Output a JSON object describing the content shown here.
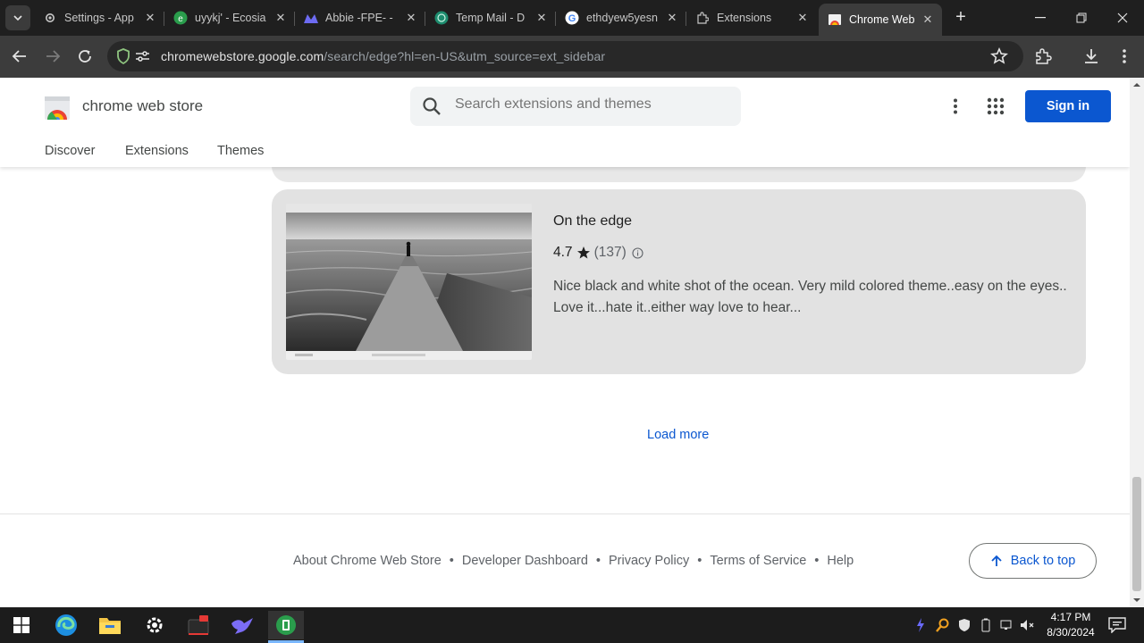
{
  "browser": {
    "tabs": [
      {
        "title": "Settings - App",
        "icon": "gear-icon"
      },
      {
        "title": "uyykj' - Ecosia",
        "icon": "ecosia-icon"
      },
      {
        "title": "Abbie -FPE- -",
        "icon": "abbie-icon"
      },
      {
        "title": "Temp Mail - D",
        "icon": "tempmail-icon"
      },
      {
        "title": "ethdyew5yesn",
        "icon": "google-icon"
      },
      {
        "title": "Extensions",
        "icon": "puzzle-icon"
      },
      {
        "title": "Chrome Web",
        "icon": "chrome-web-store-icon"
      }
    ],
    "url_main": "chromewebstore.google.com",
    "url_rest": "/search/edge?hl=en-US&utm_source=ext_sidebar"
  },
  "store": {
    "brand": "chrome web store",
    "search_placeholder": "Search extensions and themes",
    "signin": "Sign in",
    "nav": {
      "discover": "Discover",
      "extensions": "Extensions",
      "themes": "Themes"
    }
  },
  "result": {
    "title": "On the edge",
    "rating": "4.7",
    "count": "(137)",
    "description": "Nice black and white shot of the ocean. Very mild colored theme..easy on the eyes.. Love it...hate it..either way love to hear..."
  },
  "load_more": "Load more",
  "footer": {
    "links": [
      "About Chrome Web Store",
      "Developer Dashboard",
      "Privacy Policy",
      "Terms of Service",
      "Help"
    ],
    "back_to_top": "Back to top"
  },
  "taskbar": {
    "time": "4:17 PM",
    "date": "8/30/2024"
  },
  "colors": {
    "accent": "#0b57d0",
    "card": "#e2e2e2",
    "chrome_dark": "#1f1f1f"
  }
}
